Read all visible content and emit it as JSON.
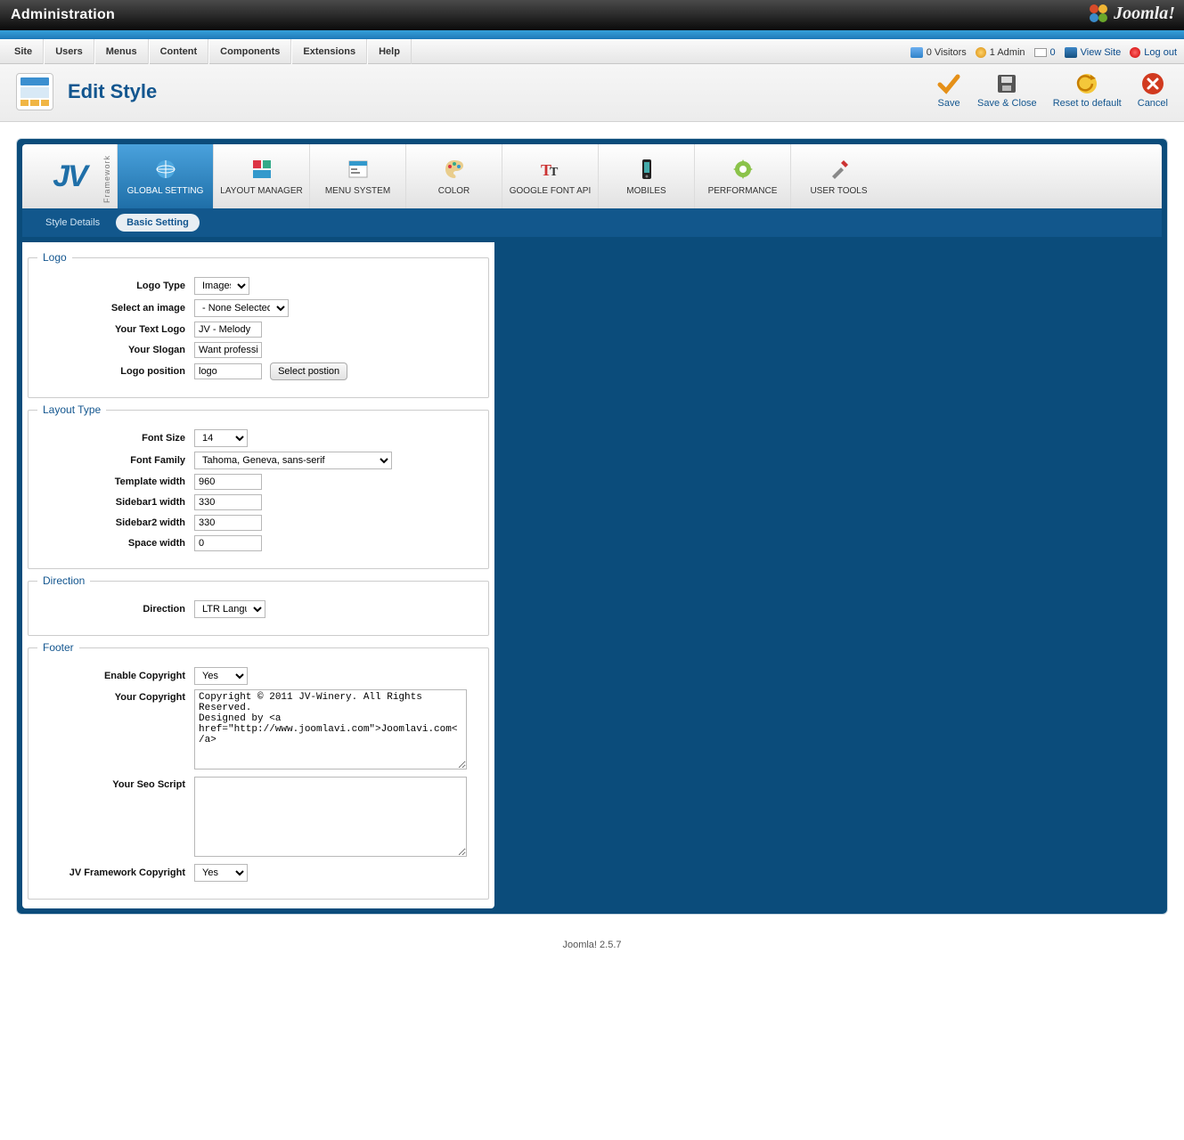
{
  "header": {
    "title": "Administration",
    "brand": "Joomla!"
  },
  "menubar": {
    "items": [
      "Site",
      "Users",
      "Menus",
      "Content",
      "Components",
      "Extensions",
      "Help"
    ],
    "status": {
      "visitors": "0 Visitors",
      "admin": "1 Admin",
      "messages": "0",
      "view_site": "View Site",
      "logout": "Log out"
    }
  },
  "page": {
    "title": "Edit Style"
  },
  "toolbar": {
    "save": "Save",
    "save_close": "Save & Close",
    "reset": "Reset to default",
    "cancel": "Cancel"
  },
  "fw_logo": {
    "text": "JV",
    "side": "Framework"
  },
  "fw_tabs": [
    {
      "label": "GLOBAL SETTING",
      "icon": "globe-icon"
    },
    {
      "label": "LAYOUT MANAGER",
      "icon": "layout-icon"
    },
    {
      "label": "MENU SYSTEM",
      "icon": "menu-icon"
    },
    {
      "label": "COLOR",
      "icon": "palette-icon"
    },
    {
      "label": "GOOGLE FONT API",
      "icon": "font-icon"
    },
    {
      "label": "MOBILES",
      "icon": "phone-icon"
    },
    {
      "label": "PERFORMANCE",
      "icon": "gear-icon"
    },
    {
      "label": "USER TOOLS",
      "icon": "tools-icon"
    }
  ],
  "sub_tabs": {
    "style_details": "Style Details",
    "basic_setting": "Basic Setting"
  },
  "sections": {
    "logo": {
      "legend": "Logo",
      "logo_type_label": "Logo Type",
      "logo_type_value": "Images",
      "select_image_label": "Select an image",
      "select_image_value": "- None Selected -",
      "text_logo_label": "Your Text Logo",
      "text_logo_value": "JV - Melody",
      "slogan_label": "Your Slogan",
      "slogan_value": "Want professional, v",
      "logo_position_label": "Logo position",
      "logo_position_value": "logo",
      "select_position_btn": "Select postion"
    },
    "layout": {
      "legend": "Layout Type",
      "font_size_label": "Font Size",
      "font_size_value": "14",
      "font_family_label": "Font Family",
      "font_family_value": "Tahoma, Geneva, sans-serif",
      "template_width_label": "Template width",
      "template_width_value": "960",
      "sidebar1_label": "Sidebar1 width",
      "sidebar1_value": "330",
      "sidebar2_label": "Sidebar2 width",
      "sidebar2_value": "330",
      "space_label": "Space width",
      "space_value": "0"
    },
    "direction": {
      "legend": "Direction",
      "direction_label": "Direction",
      "direction_value": "LTR Language"
    },
    "footer": {
      "legend": "Footer",
      "enable_copyright_label": "Enable Copyright",
      "enable_copyright_value": "Yes",
      "your_copyright_label": "Your Copyright",
      "your_copyright_value": "Copyright © 2011 JV-Winery. All Rights Reserved.\nDesigned by <a href=\"http://www.joomlavi.com\">Joomlavi.com</a>",
      "seo_label": "Your Seo Script",
      "seo_value": "",
      "jvfw_copyright_label": "JV Framework Copyright",
      "jvfw_copyright_value": "Yes"
    }
  },
  "footer_text": "Joomla! 2.5.7"
}
